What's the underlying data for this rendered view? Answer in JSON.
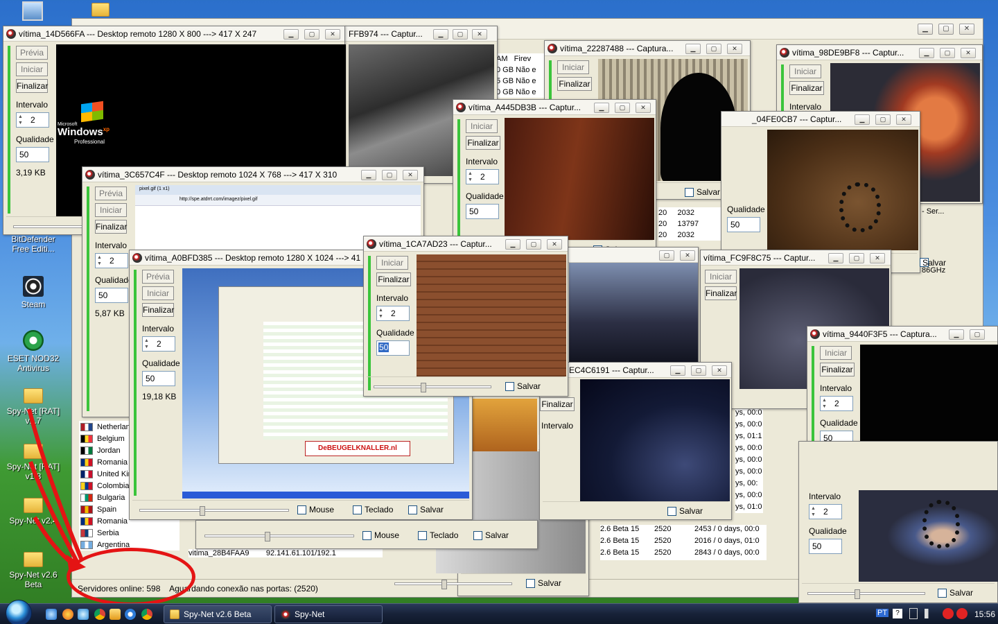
{
  "desktop": {
    "icons": [
      {
        "label": "BitDefender Free Editi..."
      },
      {
        "label": "Steam"
      },
      {
        "label": "ESET NOD32 Antivirus"
      },
      {
        "label": "Spy-Net [RAT] v1.7"
      },
      {
        "label": "Spy-Net [RAT] v1.8"
      },
      {
        "label": "Spy-Net v2.4"
      },
      {
        "label": "Spy-Net v2.6 Beta"
      }
    ]
  },
  "main_window": {
    "countries": [
      "Netherlands",
      "Belgium",
      "Jordan",
      "Romania",
      "United Kin",
      "Colombia",
      "Bulgaria",
      "Spain",
      "Romania",
      "Serbia",
      "Argentina"
    ],
    "status": {
      "servers_online": "Servidores online: 598",
      "waiting": "Aguardando conexão nas portas: (2520)"
    },
    "partial_row": {
      "name": "vitima_28B4FAA9",
      "ip": "92.141.61.101/192.1"
    },
    "right_rows": [
      {
        "ver": "2.6 Beta 15",
        "port": "2520",
        "info": "2453 / 0 days, 00:0"
      },
      {
        "ver": "2.6 Beta 15",
        "port": "2520",
        "info": "2016 / 0 days, 01:0"
      },
      {
        "ver": "2.6 Beta 15",
        "port": "2520",
        "info": "2843 / 0 days, 00:0"
      }
    ]
  },
  "labels": {
    "previa": "Prévia",
    "iniciar": "Iniciar",
    "finalizar": "Finalizar",
    "intervalo": "Intervalo",
    "qualidade": "Qualidade",
    "salvar": "Salvar",
    "mouse": "Mouse",
    "teclado": "Teclado"
  },
  "windows": {
    "w1": {
      "title": "vítima_14D566FA --- Desktop remoto 1280 X 800 ---> 417 X 247",
      "interval": "2",
      "quality": "50",
      "size": "3,19 KB"
    },
    "w2": {
      "title": "FFB974 --- Captur..."
    },
    "w3": {
      "title": "vítima_22287488 --- Captura...",
      "iniciar": "Iniciar",
      "finalizar": "Finalizar"
    },
    "w4": {
      "title": "vítima_98DE9BF8 --- Captur..."
    },
    "w5": {
      "title": "vítima_A445DB3B --- Captur...",
      "interval": "2",
      "quality": "50"
    },
    "w6": {
      "title": "_04FE0CB7 --- Captur...",
      "quality": "50"
    },
    "w7": {
      "title": "vítima_3C657C4F --- Desktop remoto 1024 X 768 ---> 417 X 310",
      "interval": "2",
      "quality": "50",
      "size": "5,87 KB"
    },
    "w8": {
      "title": "vítima_A0BFD385 --- Desktop remoto 1280 X 1024 ---> 41",
      "interval": "2",
      "quality": "50",
      "size": "19,18 KB"
    },
    "w9": {
      "title": "vítima_1CA7AD23 --- Captur...",
      "interval": "2",
      "quality": "50"
    },
    "w10": {
      "title": "vítima_FC9F8C75 --- Captur..."
    },
    "w11": {
      "title": "vítima_9440F3F5 --- Captura...",
      "interval": "2",
      "quality": "50"
    },
    "w12": {
      "title": "EC4C6191 --- Captur..."
    },
    "w13": {
      "interval": "2",
      "quality": "50"
    }
  },
  "behind_text": {
    "col_am": "AM",
    "col_fire": "Firev",
    "gb": [
      "0 GB",
      "5 GB",
      "0 GB"
    ],
    "nao": [
      "Não e",
      "Não e",
      "Não e"
    ],
    "nums1": [
      "20",
      "20",
      "20"
    ],
    "nums2": [
      "2032",
      "13797",
      "2032"
    ],
    "ser": "- Ser...",
    "ghz": "86GHz",
    "days": [
      "ys, 00:0",
      "ys, 00:0",
      "ys, 01:1",
      "ys, 00:0",
      "ys, 00:0",
      "ys, 00:0",
      "ys, 00:",
      "ys, 00:0",
      "ys, 01:0"
    ]
  },
  "browser_url": "http://spe.atdrrt.com/imagez/pixel.gif",
  "browser_tab": "pixel.gif (1 x1)",
  "screen_banner": "DeBEUGELKNALLER.nl",
  "xp_logo": {
    "microsoft": "Microsoft",
    "windows": "Windows",
    "xp": "xp",
    "edition": "Professional"
  },
  "taskbar": {
    "tasks": [
      "Spy-Net v2.6 Beta",
      "Spy-Net"
    ],
    "lang": "PT",
    "clock": "15:56"
  }
}
